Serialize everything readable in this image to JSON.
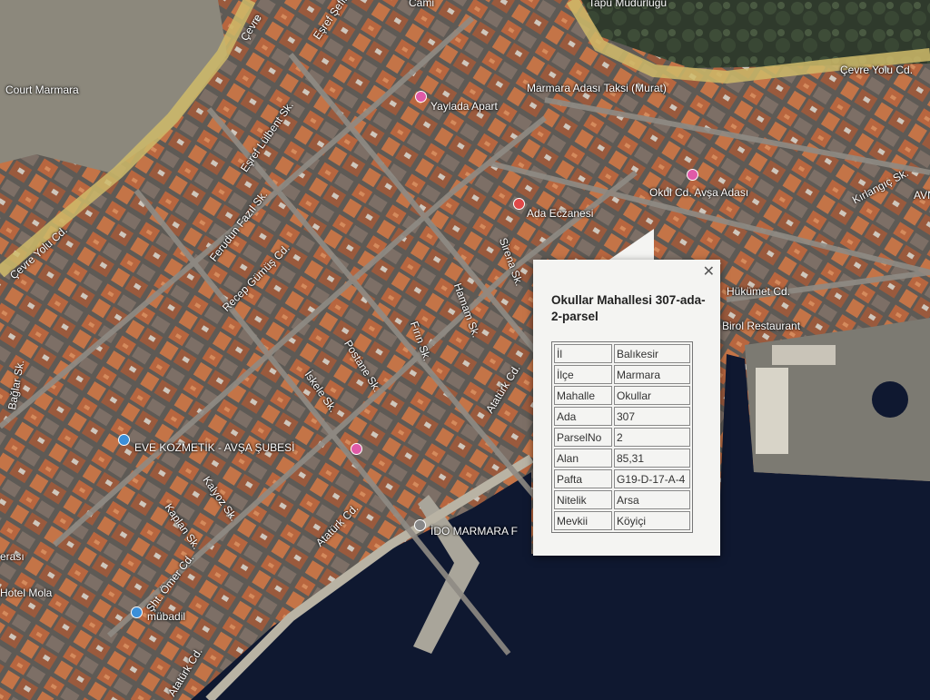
{
  "popup": {
    "title": "Okullar Mahallesi 307-ada-2-parsel",
    "close_label": "✕",
    "rows": [
      {
        "key": "İl",
        "value": "Balıkesir"
      },
      {
        "key": "İlçe",
        "value": "Marmara"
      },
      {
        "key": "Mahalle",
        "value": "Okullar"
      },
      {
        "key": "Ada",
        "value": "307"
      },
      {
        "key": "ParselNo",
        "value": "2"
      },
      {
        "key": "Alan",
        "value": "85,31"
      },
      {
        "key": "Pafta",
        "value": "G19-D-17-A-4"
      },
      {
        "key": "Nitelik",
        "value": "Arsa"
      },
      {
        "key": "Mevkii",
        "value": "Köyiçi"
      }
    ]
  },
  "map_labels": {
    "cami": "Cami",
    "tapu": "Tapu Müdürlüğü",
    "cevre_top": "Çevre",
    "cevre_right": "Çevre Yolu Cd.",
    "cevre_left": "Çevre Yolu Cd.",
    "court": "Court Marmara",
    "esref": "Eşref Şefik Sk.",
    "tulbent": "Eşref Lülbent Sk.",
    "yaylada": "Yaylada Apart",
    "taksi": "Marmara Adası Taksi (Murat)",
    "okul_cd": "Okul Cd. Avşa Adası",
    "kirlangic": "Kırlangıç Sk.",
    "ferudun": "Ferudun Fazıl Sk.",
    "recep": "Recep Gümüş Cd.",
    "eczane": "Ada Eczanesi",
    "sirena": "Sirena Sk.",
    "hamam": "Hamam Sk.",
    "firin": "Fırın Sk.",
    "postane": "Postane Sk.",
    "iskele": "İskele Sk.",
    "ataturk1": "Atatürk Cd.",
    "ataturk2": "Atatürk Cd.",
    "ataturk3": "Atatürk Cd.",
    "hukumet": "Hükümet Cd.",
    "birol": "Birol Restaurant",
    "baglar": "Bağlar Sk.",
    "eve": "EVE KOZMETİK - AVŞA ŞUBESİ",
    "kalyoz": "Kalyoz Sk.",
    "kaplan": "Kaplan Sk.",
    "ido": "İDO MARMARA F",
    "sht": "Şht. Ömer Cd.",
    "mubadil": "mübadil",
    "hotel": "Hotel Mola",
    "erasi": "erası",
    "avni": "AVNİ"
  }
}
